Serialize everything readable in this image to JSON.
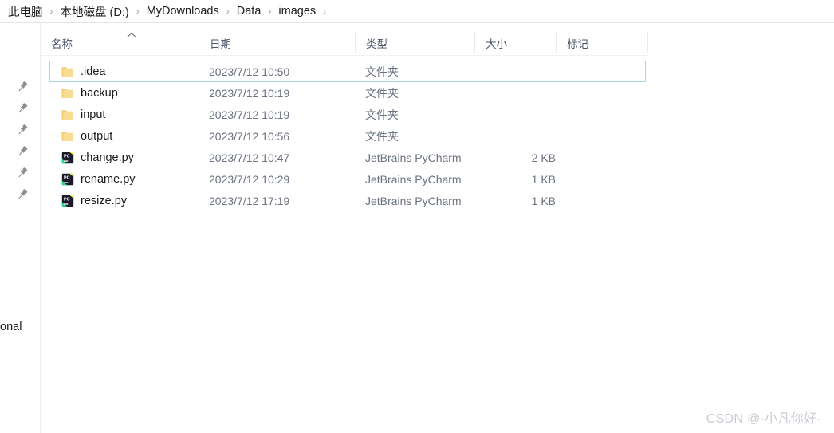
{
  "breadcrumb": {
    "separator": "›",
    "items": [
      {
        "label": "此电脑"
      },
      {
        "label": "本地磁盘 (D:)"
      },
      {
        "label": "MyDownloads"
      },
      {
        "label": "Data"
      },
      {
        "label": "images"
      }
    ]
  },
  "left_rail": {
    "pin_icon_name": "pin-icon",
    "pin_count": 6,
    "partial_label": "onal"
  },
  "columns": {
    "name": "名称",
    "date": "日期",
    "type": "类型",
    "size": "大小",
    "tag": "标记",
    "sort_caret_icon": "chevron-up-icon",
    "sort_direction": "ascending",
    "sorted_by": "名称"
  },
  "files": [
    {
      "name": ".idea",
      "date": "2023/7/12 10:50",
      "type": "文件夹",
      "size": "",
      "tag": "",
      "icon": "folder-icon",
      "selected": true
    },
    {
      "name": "backup",
      "date": "2023/7/12 10:19",
      "type": "文件夹",
      "size": "",
      "tag": "",
      "icon": "folder-icon",
      "selected": false
    },
    {
      "name": "input",
      "date": "2023/7/12 10:19",
      "type": "文件夹",
      "size": "",
      "tag": "",
      "icon": "folder-icon",
      "selected": false
    },
    {
      "name": "output",
      "date": "2023/7/12 10:56",
      "type": "文件夹",
      "size": "",
      "tag": "",
      "icon": "folder-icon",
      "selected": false
    },
    {
      "name": "change.py",
      "date": "2023/7/12 10:47",
      "type": "JetBrains PyCharm",
      "size": "2 KB",
      "tag": "",
      "icon": "pycharm-file-icon",
      "selected": false
    },
    {
      "name": "rename.py",
      "date": "2023/7/12 10:29",
      "type": "JetBrains PyCharm",
      "size": "1 KB",
      "tag": "",
      "icon": "pycharm-file-icon",
      "selected": false
    },
    {
      "name": "resize.py",
      "date": "2023/7/12 17:19",
      "type": "JetBrains PyCharm",
      "size": "1 KB",
      "tag": "",
      "icon": "pycharm-file-icon",
      "selected": false
    }
  ],
  "watermark": {
    "text": "CSDN @-小凡你好-"
  },
  "colors": {
    "selection_border": "#aed3e5",
    "folder": "#f5d98a",
    "text_primary": "#1b1b1b",
    "text_secondary": "#6b7280",
    "header_text": "#4a5568",
    "divider": "#ebebeb",
    "watermark": "#c9ccd1"
  }
}
